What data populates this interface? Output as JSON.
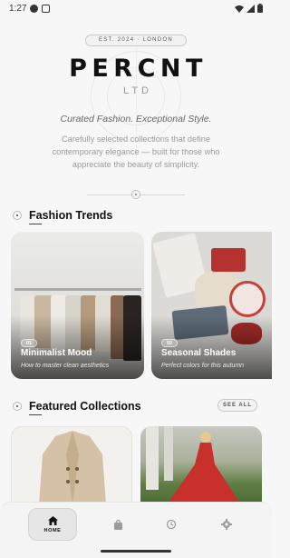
{
  "status_bar": {
    "time": "1:27",
    "left_icons": [
      "shield-icon",
      "image-icon"
    ],
    "right_icons": [
      "wifi-icon",
      "signal-icon",
      "battery-icon"
    ]
  },
  "hero": {
    "badge": "EST. 2024 · LONDON",
    "brand": "PERCNT",
    "brand_sub": "LTD",
    "tagline": "Curated Fashion. Exceptional Style.",
    "description": "Carefully selected collections that define contemporary elegance — built for those who appreciate the beauty of simplicity."
  },
  "trends": {
    "title": "Fashion Trends",
    "cards": [
      {
        "badge": "01",
        "title": "Minimalist Mood",
        "subtitle": "How to master clean aesthetics"
      },
      {
        "badge": "02",
        "title": "Seasonal Shades",
        "subtitle": "Perfect colors for this autumn"
      }
    ]
  },
  "featured": {
    "title": "Featured Collections",
    "see_all": "SEE ALL"
  },
  "bottom_nav": {
    "items": [
      {
        "label": "HOME",
        "icon": "home-icon",
        "active": true
      },
      {
        "label": "",
        "icon": "bag-icon",
        "active": false
      },
      {
        "label": "",
        "icon": "history-icon",
        "active": false
      },
      {
        "label": "",
        "icon": "gear-icon",
        "active": false
      }
    ]
  },
  "colors": {
    "background": "#f7f7f7",
    "text_primary": "#111111",
    "text_muted": "#9a9a9a",
    "accent_red": "#c8302c"
  }
}
